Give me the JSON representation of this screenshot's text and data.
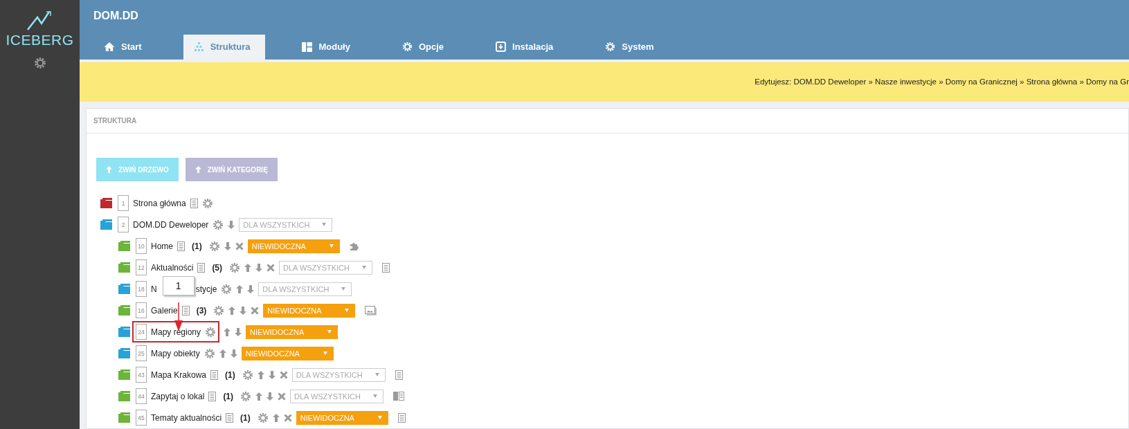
{
  "sidebar": {
    "logo": "ICEBERG"
  },
  "header": {
    "title": "DOM.DD"
  },
  "tabs": [
    {
      "label": "Start",
      "selected": false
    },
    {
      "label": "Struktura",
      "selected": true
    },
    {
      "label": "Moduły",
      "selected": false
    },
    {
      "label": "Opcje",
      "selected": false
    },
    {
      "label": "Instalacja",
      "selected": false
    },
    {
      "label": "System",
      "selected": false
    }
  ],
  "notice": {
    "text": "Edytujesz: DOM.DD Deweloper » Nasze inwestycje » Domy na Granicznej » Strona główna » Domy na Gr"
  },
  "panel": {
    "title": "STRUKTURA",
    "buttons": [
      {
        "label": "ZWIŃ DRZEWO",
        "kind": "primary"
      },
      {
        "label": "ZWIŃ KATEGORIĘ",
        "kind": "secondary"
      }
    ]
  },
  "tree": [
    {
      "id": "1",
      "label": "Strona główna",
      "color": "#c0282e",
      "page": true,
      "annotated": false,
      "up": false,
      "down": false,
      "delete": false
    },
    {
      "id": "2",
      "label": "DOM.DD Deweloper",
      "color": "#29a3d6",
      "page": false,
      "annotated": false,
      "up": false,
      "down": true,
      "delete": false,
      "dropdown": {
        "value": "DLA WSZYSTKICH",
        "highlighted": false
      },
      "children": [
        {
          "id": "10",
          "label": "Home",
          "kind": "module",
          "color": "#6cb43c",
          "page": true,
          "annotated": false,
          "count": "(1)",
          "up": false,
          "down": true,
          "delete": true,
          "dropdown": {
            "value": "NIEWIDOCZNA",
            "highlighted": true
          }
        },
        {
          "id": "12",
          "label": "Aktualności",
          "kind": "list",
          "color": "#6cb43c",
          "page": true,
          "annotated": false,
          "count": "(5)",
          "up": true,
          "down": true,
          "delete": true,
          "dropdown": {
            "value": "DLA WSZYSTKICH",
            "highlighted": false
          }
        },
        {
          "id": "18",
          "label": "N",
          "label_tail": "stycje",
          "callout": "1",
          "color": "#29a3d6",
          "page": false,
          "annotated": false,
          "up": true,
          "down": true,
          "delete": false,
          "dropdown": {
            "value": "DLA WSZYSTKICH",
            "highlighted": false
          }
        },
        {
          "id": "16",
          "label": "Galerie",
          "kind": "gallery",
          "color": "#6cb43c",
          "page": true,
          "annotated": false,
          "count": "(3)",
          "up": true,
          "down": true,
          "delete": true,
          "dropdown": {
            "value": "NIEWIDOCZNA",
            "highlighted": true
          }
        },
        {
          "id": "24",
          "label": "Mapy regiony",
          "color": "#29a3d6",
          "page": false,
          "annotated": true,
          "up": true,
          "down": true,
          "delete": false,
          "dropdown": {
            "value": "NIEWIDOCZNA",
            "highlighted": true
          }
        },
        {
          "id": "25",
          "label": "Mapy obiekty",
          "color": "#29a3d6",
          "page": false,
          "annotated": false,
          "up": true,
          "down": true,
          "delete": false,
          "dropdown": {
            "value": "NIEWIDOCZNA",
            "highlighted": true
          }
        },
        {
          "id": "43",
          "label": "Mapa Krakowa",
          "kind": "list",
          "color": "#6cb43c",
          "page": true,
          "annotated": false,
          "count": "(1)",
          "up": true,
          "down": true,
          "delete": true,
          "dropdown": {
            "value": "DLA WSZYSTKICH",
            "highlighted": false
          }
        },
        {
          "id": "44",
          "label": "Zapytaj o lokal",
          "kind": "form",
          "color": "#6cb43c",
          "page": true,
          "annotated": false,
          "count": "(1)",
          "up": true,
          "down": true,
          "delete": true,
          "dropdown": {
            "value": "DLA WSZYSTKICH",
            "highlighted": false
          }
        },
        {
          "id": "45",
          "label": "Tematy aktualności",
          "kind": "list",
          "color": "#6cb43c",
          "page": true,
          "annotated": false,
          "count": "(1)",
          "up": true,
          "down": false,
          "delete": true,
          "dropdown": {
            "value": "NIEWIDOCZNA",
            "highlighted": true
          }
        }
      ]
    }
  ]
}
